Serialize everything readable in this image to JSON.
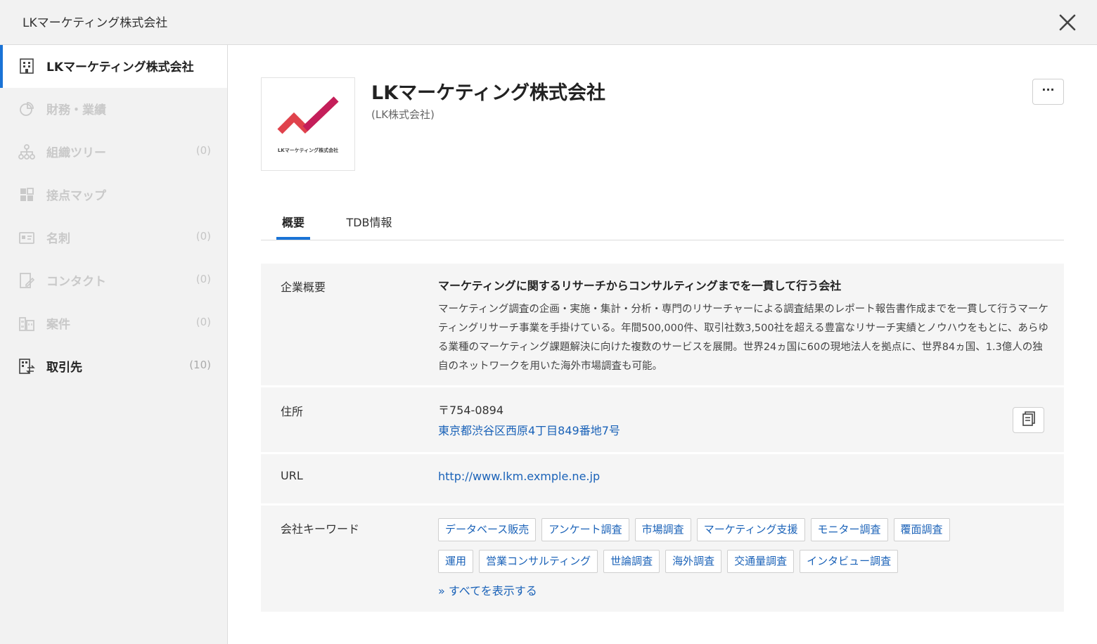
{
  "window": {
    "title": "LKマーケティング株式会社"
  },
  "sidebar": {
    "items": [
      {
        "label": "LKマーケティング株式会社",
        "count": ""
      },
      {
        "label": "財務・業績",
        "count": ""
      },
      {
        "label": "組織ツリー",
        "count": "(0)"
      },
      {
        "label": "接点マップ",
        "count": ""
      },
      {
        "label": "名刺",
        "count": "(0)"
      },
      {
        "label": "コンタクト",
        "count": "(0)"
      },
      {
        "label": "案件",
        "count": "(0)"
      },
      {
        "label": "取引先",
        "count": "(10)"
      }
    ]
  },
  "company": {
    "name": "LKマーケティング株式会社",
    "short_name": "(LK株式会社)",
    "logo_text": "LKマーケティング株式会社",
    "more_label": "···"
  },
  "tabs": [
    {
      "label": "概要"
    },
    {
      "label": "TDB情報"
    }
  ],
  "overview": {
    "label": "企業概要",
    "title": "マーケティングに関するリサーチからコンサルティングまでを一貫して行う会社",
    "description": "マーケティング調査の企画・実施・集計・分析・専門のリサーチャーによる調査結果のレポート報告書作成までを一貫して行うマーケティングリサーチ事業を手掛けている。年間500,000件、取引社数3,500社を超える豊富なリサーチ実績とノウハウをもとに、あらゆる業種のマーケティング課題解決に向けた複数のサービスを展開。世界24ヵ国に60の現地法人を拠点に、世界84ヵ国、1.3億人の独自のネットワークを用いた海外市場調査も可能。"
  },
  "address": {
    "label": "住所",
    "postal": "〒754-0894",
    "street": "東京都渋谷区西原4丁目849番地7号"
  },
  "url": {
    "label": "URL",
    "value": "http://www.lkm.exmple.ne.jp"
  },
  "keywords": {
    "label": "会社キーワード",
    "items": [
      "データベース販売",
      "アンケート調査",
      "市場調査",
      "マーケティング支援",
      "モニター調査",
      "覆面調査",
      "運用",
      "営業コンサルティング",
      "世論調査",
      "海外調査",
      "交通量調査",
      "インタビュー調査"
    ],
    "show_all": "» すべてを表示する"
  },
  "colors": {
    "accent": "#1a73d6",
    "link": "#1a62b8",
    "logo_red": "#e0424c",
    "logo_crimson": "#c41e5a"
  }
}
